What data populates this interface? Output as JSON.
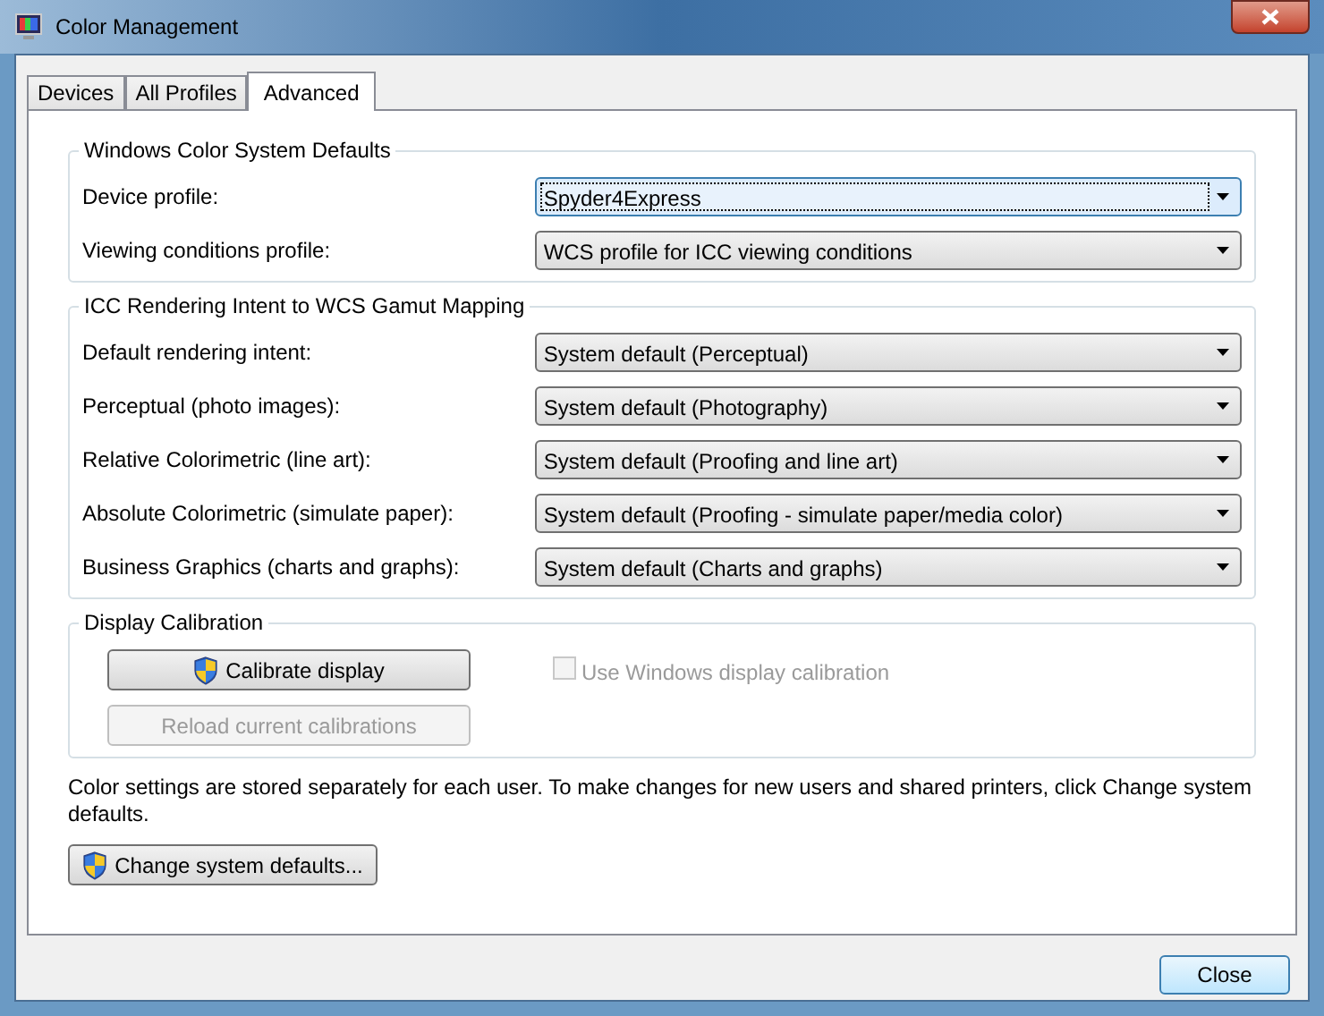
{
  "window": {
    "title": "Color Management"
  },
  "tabs": [
    {
      "label": "Devices",
      "selected": false
    },
    {
      "label": "All Profiles",
      "selected": false
    },
    {
      "label": "Advanced",
      "selected": true
    }
  ],
  "groups": [
    {
      "title": "Windows Color System Defaults",
      "rows": [
        {
          "label": "Device profile:",
          "value": "Spyder4Express",
          "focused": true
        },
        {
          "label": "Viewing conditions profile:",
          "value": "WCS profile for ICC viewing conditions",
          "focused": false
        }
      ]
    },
    {
      "title": "ICC Rendering Intent to WCS Gamut Mapping",
      "rows": [
        {
          "label": "Default rendering intent:",
          "value": "System default (Perceptual)",
          "focused": false
        },
        {
          "label": "Perceptual (photo images):",
          "value": "System default (Photography)",
          "focused": false
        },
        {
          "label": "Relative Colorimetric (line art):",
          "value": "System default (Proofing and line art)",
          "focused": false
        },
        {
          "label": "Absolute Colorimetric (simulate paper):",
          "value": "System default (Proofing - simulate paper/media color)",
          "focused": false
        },
        {
          "label": "Business Graphics (charts and graphs):",
          "value": "System default (Charts and graphs)",
          "focused": false
        }
      ]
    }
  ],
  "calibration": {
    "title": "Display Calibration",
    "calibrate_button": {
      "label": "Calibrate display",
      "disabled": false
    },
    "reload_button": {
      "label": "Reload current calibrations",
      "disabled": true
    },
    "checkbox": {
      "label": "Use Windows display calibration",
      "checked": false,
      "disabled": true
    }
  },
  "note": "Color settings are stored separately for each user. To make changes for new users and shared printers, click Change system defaults.",
  "change_button": {
    "label": "Change system defaults...",
    "disabled": false
  },
  "buttons": [
    {
      "label": "Close"
    }
  ]
}
